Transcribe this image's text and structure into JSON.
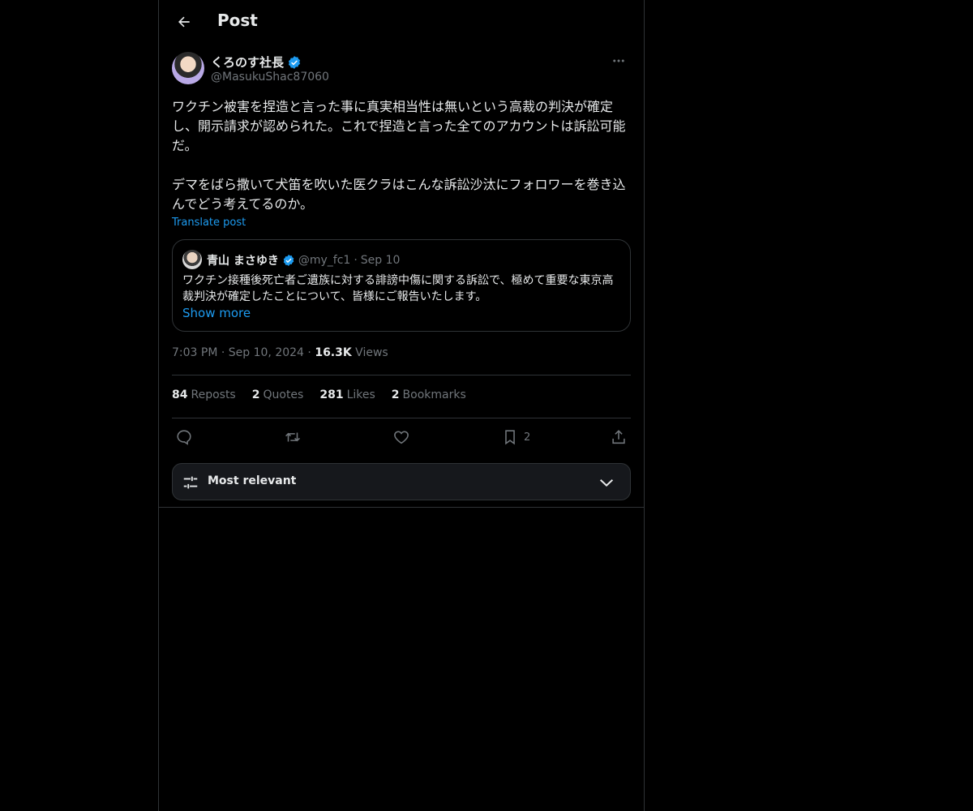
{
  "header": {
    "title": "Post"
  },
  "post": {
    "author_name": "くろのす社長",
    "author_handle": "@MasukuShac87060",
    "text": "ワクチン被害を捏造と言った事に真実相当性は無いという高裁の判決が確定し、開示請求が認められた。これで捏造と言った全てのアカウントは訴訟可能だ。\n\nデマをばら撒いて犬笛を吹いた医クラはこんな訴訟沙汰にフォロワーを巻き込んでどう考えてるのか。",
    "translate_label": "Translate post",
    "time": "7:03 PM",
    "date": "Sep 10, 2024",
    "views_count": "16.3K",
    "views_label": "Views",
    "separator": "·"
  },
  "quote": {
    "author_name": "青山 まさゆき",
    "author_handle": "@my_fc1",
    "separator": "·",
    "date": "Sep 10",
    "text": "ワクチン接種後死亡者ご遺族に対する誹謗中傷に関する訴訟で、極めて重要な東京高裁判決が確定したことについて、皆様にご報告いたします。",
    "show_more": "Show more"
  },
  "stats": {
    "reposts_count": "84",
    "reposts_label": "Reposts",
    "quotes_count": "2",
    "quotes_label": "Quotes",
    "likes_count": "281",
    "likes_label": "Likes",
    "bookmarks_count": "2",
    "bookmarks_label": "Bookmarks"
  },
  "actions": {
    "bookmark_count": "2"
  },
  "sort": {
    "label": "Most relevant"
  },
  "colors": {
    "background": "#000000",
    "accent": "#1d9bf0",
    "text": "#e7e9ea",
    "muted": "#71767b",
    "border": "#2f3336"
  },
  "icons": [
    "back-arrow-icon",
    "verified-badge-icon",
    "more-icon",
    "reply-icon",
    "repost-icon",
    "like-icon",
    "bookmark-icon",
    "share-icon",
    "sliders-icon",
    "chevron-down-icon"
  ]
}
